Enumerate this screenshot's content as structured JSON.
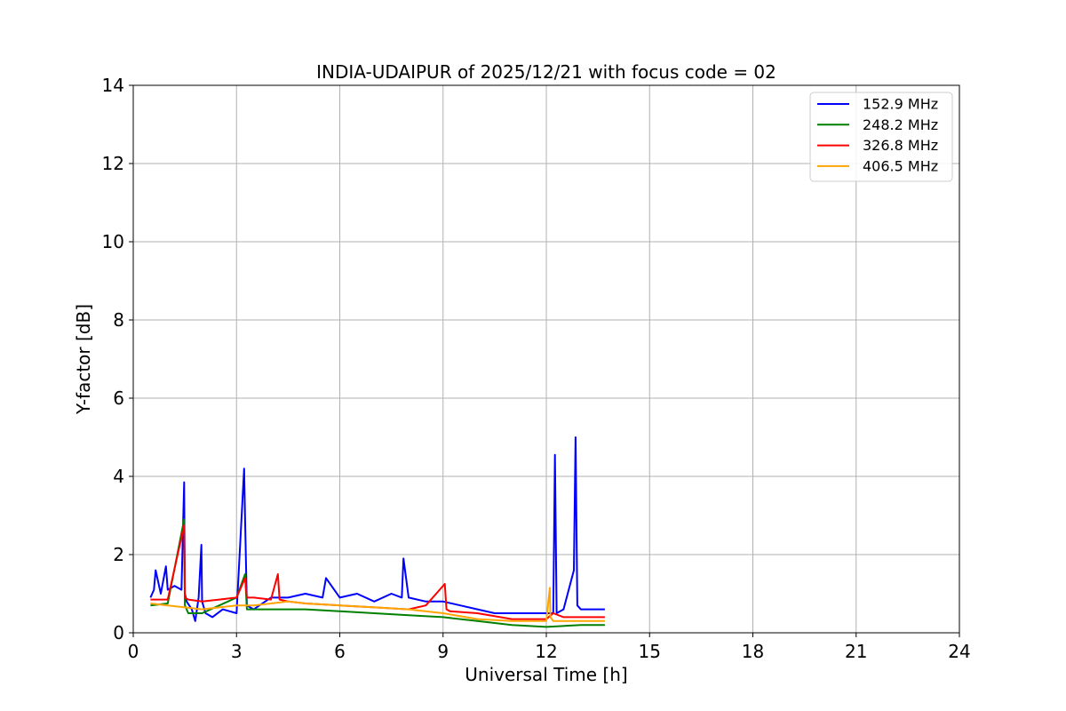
{
  "chart_data": {
    "type": "line",
    "title": "INDIA-UDAIPUR of 2025/12/21 with focus code = 02",
    "xlabel": "Universal Time [h]",
    "ylabel": "Y-factor [dB]",
    "xlim": [
      0,
      24
    ],
    "ylim": [
      0,
      14
    ],
    "xticks": [
      0,
      3,
      6,
      9,
      12,
      15,
      18,
      21,
      24
    ],
    "yticks": [
      0,
      2,
      4,
      6,
      8,
      10,
      12,
      14
    ],
    "grid": true,
    "legend_position": "top-right",
    "series": [
      {
        "name": "152.9 MHz",
        "color": "#0000ff",
        "x": [
          0.5,
          0.6,
          0.65,
          0.8,
          0.95,
          1.0,
          1.2,
          1.4,
          1.48,
          1.5,
          1.55,
          1.7,
          1.8,
          1.9,
          1.98,
          2.0,
          2.1,
          2.3,
          2.6,
          3.0,
          3.22,
          3.25,
          3.3,
          3.5,
          4.0,
          4.5,
          5.0,
          5.5,
          5.6,
          6.0,
          6.5,
          7.0,
          7.5,
          7.8,
          7.85,
          8.0,
          8.5,
          9.0,
          9.5,
          10.0,
          10.5,
          11.0,
          11.5,
          12.0,
          12.2,
          12.25,
          12.3,
          12.5,
          12.8,
          12.85,
          12.9,
          13.0,
          13.3,
          13.7
        ],
        "y": [
          0.9,
          1.1,
          1.6,
          1.0,
          1.7,
          1.1,
          1.2,
          1.1,
          3.85,
          1.0,
          0.8,
          0.6,
          0.3,
          0.9,
          2.25,
          0.8,
          0.5,
          0.4,
          0.6,
          0.5,
          4.2,
          2.9,
          0.7,
          0.6,
          0.9,
          0.9,
          1.0,
          0.9,
          1.4,
          0.9,
          1.0,
          0.8,
          1.0,
          0.9,
          1.9,
          0.9,
          0.8,
          0.8,
          0.7,
          0.6,
          0.5,
          0.5,
          0.5,
          0.5,
          0.5,
          4.55,
          0.5,
          0.6,
          1.6,
          5.0,
          0.7,
          0.6,
          0.6,
          0.6
        ]
      },
      {
        "name": "248.2 MHz",
        "color": "#008000",
        "x": [
          0.5,
          1.0,
          1.48,
          1.5,
          1.6,
          2.0,
          3.0,
          3.25,
          3.3,
          4.0,
          5.0,
          6.0,
          7.0,
          8.0,
          9.0,
          10.0,
          11.0,
          12.0,
          13.0,
          13.7
        ],
        "y": [
          0.7,
          0.75,
          2.9,
          0.7,
          0.5,
          0.5,
          0.9,
          1.5,
          0.6,
          0.6,
          0.6,
          0.55,
          0.5,
          0.45,
          0.4,
          0.3,
          0.2,
          0.15,
          0.2,
          0.2
        ]
      },
      {
        "name": "326.8 MHz",
        "color": "#ff0000",
        "x": [
          0.5,
          1.0,
          1.48,
          1.5,
          1.6,
          2.0,
          2.5,
          3.0,
          3.25,
          3.3,
          3.5,
          4.0,
          4.2,
          4.25,
          4.5,
          5.0,
          6.0,
          7.0,
          8.0,
          8.5,
          9.05,
          9.1,
          9.2,
          10.0,
          11.0,
          12.0,
          12.2,
          12.5,
          13.0,
          13.7
        ],
        "y": [
          0.85,
          0.85,
          2.75,
          0.9,
          0.85,
          0.8,
          0.85,
          0.9,
          1.4,
          0.9,
          0.9,
          0.85,
          1.5,
          0.85,
          0.8,
          0.75,
          0.7,
          0.65,
          0.6,
          0.7,
          1.25,
          0.6,
          0.55,
          0.5,
          0.35,
          0.35,
          0.5,
          0.4,
          0.4,
          0.4
        ]
      },
      {
        "name": "406.5 MHz",
        "color": "#ffa500",
        "x": [
          0.5,
          1.0,
          1.5,
          2.0,
          2.5,
          3.0,
          3.5,
          4.0,
          4.5,
          5.0,
          6.0,
          7.0,
          8.0,
          9.0,
          10.0,
          11.0,
          12.0,
          12.1,
          12.12,
          12.2,
          13.0,
          13.7
        ],
        "y": [
          0.75,
          0.7,
          0.65,
          0.6,
          0.65,
          0.7,
          0.7,
          0.75,
          0.8,
          0.75,
          0.7,
          0.65,
          0.6,
          0.5,
          0.35,
          0.3,
          0.3,
          1.15,
          0.4,
          0.3,
          0.3,
          0.3
        ]
      }
    ]
  }
}
